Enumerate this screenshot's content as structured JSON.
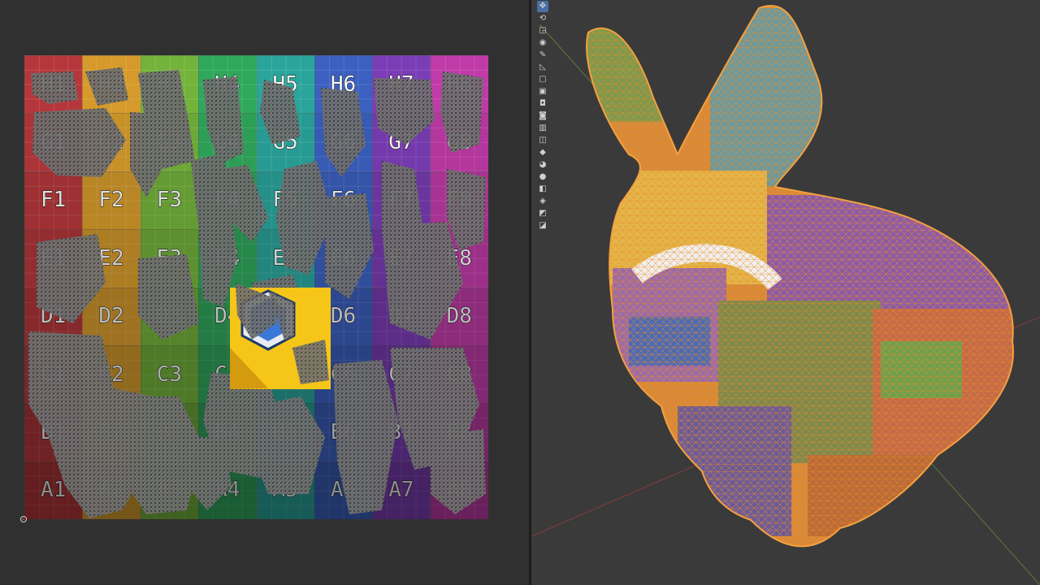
{
  "uv_editor": {
    "grid_rows": [
      "H",
      "G",
      "F",
      "E",
      "D",
      "C",
      "B",
      "A"
    ],
    "grid_cols": [
      "1",
      "2",
      "3",
      "4",
      "5",
      "6",
      "7",
      "8"
    ],
    "column_colors": [
      "#b6373b",
      "#d59a2b",
      "#73b33b",
      "#30a85c",
      "#2aa59c",
      "#3b60c0",
      "#7b3db6",
      "#c03ba8"
    ]
  },
  "viewport": {
    "tools": [
      {
        "icon": "cursor-icon",
        "glyph": "✥"
      },
      {
        "icon": "move-icon",
        "glyph": "⟲"
      },
      {
        "icon": "scale-icon",
        "glyph": "◲"
      },
      {
        "icon": "transform-icon",
        "glyph": "◉"
      },
      {
        "icon": "annotate-icon",
        "glyph": "✎"
      },
      {
        "icon": "measure-icon",
        "glyph": "◺"
      },
      {
        "icon": "add-cube-icon",
        "glyph": "▢"
      },
      {
        "icon": "extrude-icon",
        "glyph": "▣"
      },
      {
        "icon": "inset-icon",
        "glyph": "◘"
      },
      {
        "icon": "bevel-icon",
        "glyph": "◙"
      },
      {
        "icon": "loop-cut-icon",
        "glyph": "▥"
      },
      {
        "icon": "knife-icon",
        "glyph": "◫"
      },
      {
        "icon": "poly-build-icon",
        "glyph": "◆"
      },
      {
        "icon": "spin-icon",
        "glyph": "◕"
      },
      {
        "icon": "smooth-icon",
        "glyph": "●"
      },
      {
        "icon": "edge-slide-icon",
        "glyph": "◧"
      },
      {
        "icon": "shrink-icon",
        "glyph": "◈"
      },
      {
        "icon": "shear-icon",
        "glyph": "◩"
      },
      {
        "icon": "rip-icon",
        "glyph": "◪"
      }
    ]
  }
}
